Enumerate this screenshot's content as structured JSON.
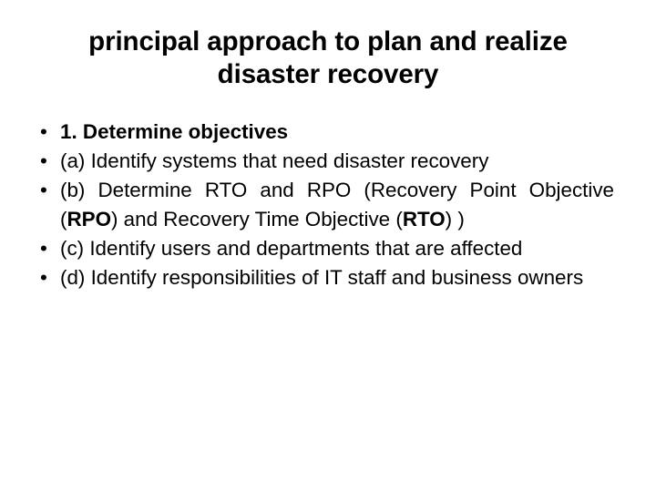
{
  "slide": {
    "title": "principal approach to plan and realize disaster recovery",
    "title_line_1": "principal approach to plan and realize",
    "title_line_2": "disaster recovery",
    "background_color": "#ffffff",
    "text_color": "#000000",
    "bullet_glyph": "•",
    "bullets": [
      {
        "marker": "•",
        "text": "1. Determine objectives",
        "bold": true
      },
      {
        "marker": "•",
        "text": "(a) Identify systems that need disaster recovery",
        "bold": false
      },
      {
        "marker": "•",
        "text": "(b) Determine RTO and RPO (Recovery Point Objective (RPO) and Recovery Time Objective (RTO) )",
        "bold": false,
        "segments": [
          {
            "text": "(b) Determine RTO and RPO (Recovery Point Objective (",
            "bold": false
          },
          {
            "text": "RPO",
            "bold": true
          },
          {
            "text": ") and Recovery Time Objective (",
            "bold": false
          },
          {
            "text": "RTO",
            "bold": true
          },
          {
            "text": ") )",
            "bold": false
          }
        ]
      },
      {
        "marker": "•",
        "text": "(c) Identify users and departments that are affected",
        "bold": false
      },
      {
        "marker": "•",
        "text": "(d) Identify responsibilities of IT staff and business owners",
        "bold": false
      }
    ]
  }
}
